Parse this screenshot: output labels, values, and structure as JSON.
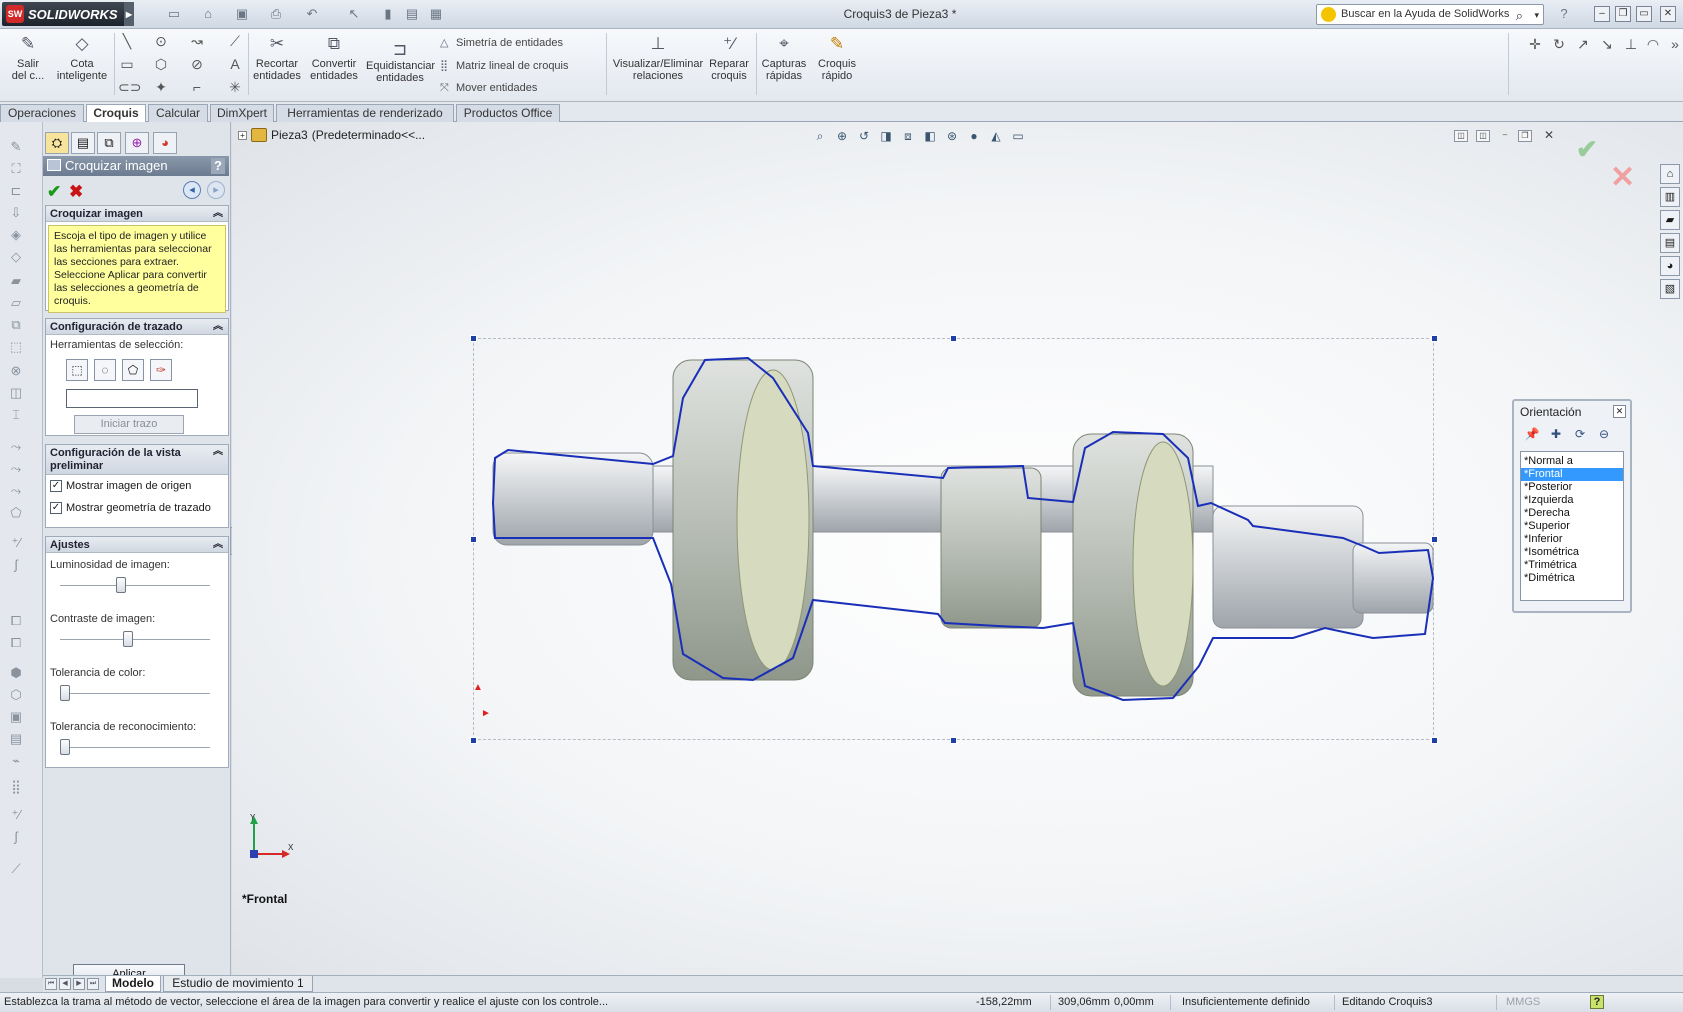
{
  "app": {
    "logo_text": "SOLIDWORKS",
    "logo_mark": "SW",
    "window_title": "Croquis3 de Pieza3 *",
    "help_search_placeholder": "Buscar en la Ayuda de SolidWorks"
  },
  "ribbon": {
    "exit_sketch": [
      "Salir",
      "del c..."
    ],
    "smart_dimension": [
      "Cota",
      "inteligente"
    ],
    "trim": [
      "Recortar",
      "entidades"
    ],
    "convert": [
      "Convertir",
      "entidades"
    ],
    "offset": [
      "Equidistanciar",
      "entidades"
    ],
    "mirror": "Simetría de entidades",
    "linear_pattern": "Matriz lineal de croquis",
    "move": "Mover entidades",
    "relations": [
      "Visualizar/Eliminar",
      "relaciones"
    ],
    "repair": [
      "Reparar",
      "croquis"
    ],
    "snaps": [
      "Capturas",
      "rápidas"
    ],
    "rapid_sketch": [
      "Croquis",
      "rápido"
    ]
  },
  "tabs": [
    "Operaciones",
    "Croquis",
    "Calcular",
    "DimXpert",
    "Herramientas de renderizado",
    "Productos Office"
  ],
  "active_tab": "Croquis",
  "property_manager": {
    "title": "Croquizar imagen",
    "help": "?",
    "group1": {
      "title": "Croquizar imagen",
      "message": "Escoja el tipo de imagen y utilice las herramientas para seleccionar las secciones para extraer. Seleccione Aplicar para convertir las selecciones a geometría de croquis."
    },
    "group2": {
      "title": "Configuración de trazado",
      "tools_label": "Herramientas de selección:",
      "start_trace": "Iniciar trazo"
    },
    "group3": {
      "title": "Configuración de la vista preliminar",
      "show_source": "Mostrar imagen de origen",
      "show_trace": "Mostrar geometría de trazado"
    },
    "group4": {
      "title": "Ajustes",
      "brightness_label": "Luminosidad de imagen:",
      "brightness_value": 0.4,
      "contrast_label": "Contraste de imagen:",
      "contrast_value": 0.45,
      "color_tol_label": "Tolerancia de color:",
      "color_tol_value": 0.0,
      "recog_tol_label": "Tolerancia de reconocimiento:",
      "recog_tol_value": 0.0
    },
    "apply": "Aplicar"
  },
  "viewport": {
    "tree_part": "Pieza3",
    "tree_config": "(Predeterminado<<...",
    "view_name": "*Frontal",
    "triad_x": "X",
    "triad_y": "Y"
  },
  "orientation": {
    "title": "Orientación",
    "items": [
      "*Normal a",
      "*Frontal",
      "*Posterior",
      "*Izquierda",
      "*Derecha",
      "*Superior",
      "*Inferior",
      "*Isométrica",
      "*Trimétrica",
      "*Dimétrica"
    ],
    "selected": "*Frontal"
  },
  "model_tabs": [
    "Modelo",
    "Estudio de movimiento 1"
  ],
  "status": {
    "message": "Establezca la trama al método de vector, seleccione el área de la imagen para convertir y realice el ajuste con los controle...",
    "x": "-158,22mm",
    "y": "309,06mm",
    "z": "0,00mm",
    "state": "Insuficientemente definido",
    "editing": "Editando Croquis3",
    "units": "MMGS",
    "help": "?"
  },
  "colors": {
    "trace": "#1a2fb8",
    "highlight": "#3399ff"
  }
}
